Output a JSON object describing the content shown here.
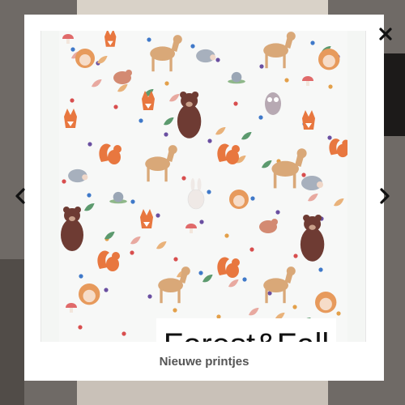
{
  "lightbox": {
    "brand_title": "Forest&Fall",
    "caption": "Nieuwe printjes",
    "close_icon": "close-icon",
    "prev_icon": "chevron-left-icon",
    "next_icon": "chevron-right-icon"
  },
  "colors": {
    "overlay": "#6f6a66",
    "modal_bg": "#ffffff",
    "fabric_bg": "#f7f8f7",
    "fox_orange": "#e8773f",
    "bear_brown": "#6e3b33",
    "deer_tan": "#d9a878",
    "hedgehog_gray": "#a7b0bd",
    "leaf_green": "#5c9a6e",
    "caption_text": "#555555"
  }
}
